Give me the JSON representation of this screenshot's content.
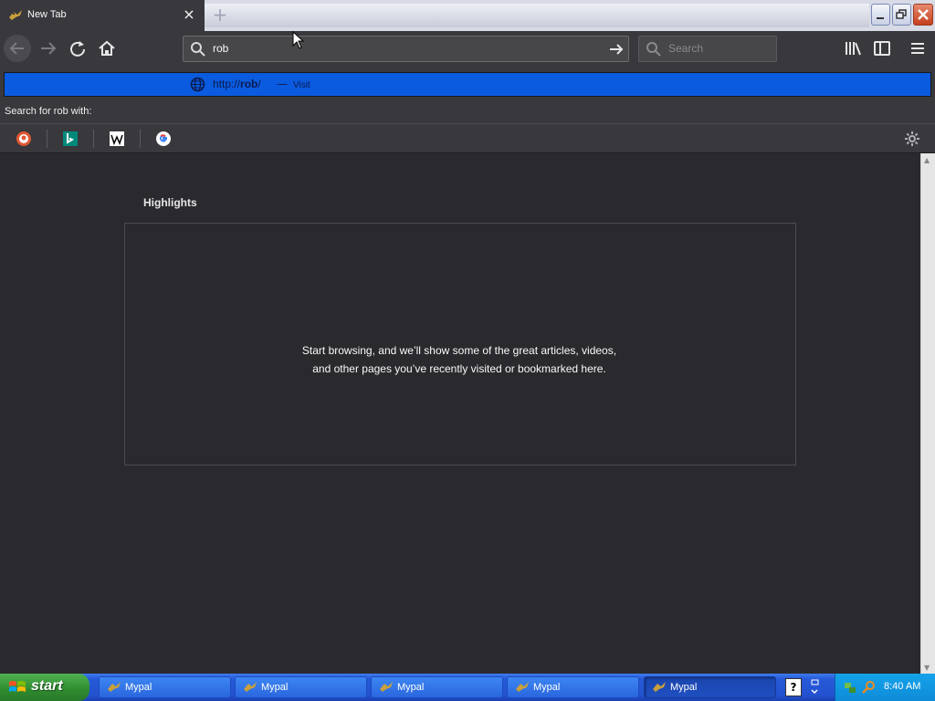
{
  "browser": {
    "tab": {
      "title": "New Tab",
      "close_glyph": "×"
    },
    "new_tab_glyph": "+",
    "url_value": "rob",
    "search_placeholder": "Search"
  },
  "autocomplete": {
    "result": {
      "url_prefix": "http://",
      "url_match": "rob",
      "url_suffix": "/",
      "separator": "—",
      "action": "Visit"
    },
    "search_with_label": "Search for rob with:",
    "engines": [
      "duckduckgo-icon",
      "bing-icon",
      "wikipedia-icon",
      "google-icon"
    ]
  },
  "content": {
    "highlights_title": "Highlights",
    "empty_message": "Start browsing, and we’ll show some of the great articles, videos, and other pages you’ve recently visited or bookmarked here."
  },
  "taskbar": {
    "start_label": "start",
    "tasks": [
      {
        "label": "Mypal",
        "active": false
      },
      {
        "label": "Mypal",
        "active": false
      },
      {
        "label": "Mypal",
        "active": false
      },
      {
        "label": "Mypal",
        "active": false
      },
      {
        "label": "Mypal",
        "active": true
      }
    ],
    "help_glyph": "?",
    "clock": "8:40 AM"
  },
  "colors": {
    "accent": "#0a5bdf",
    "toolbar": "#38383d",
    "content_bg": "#2a2a2e",
    "taskbar_blue": "#2659d8"
  }
}
